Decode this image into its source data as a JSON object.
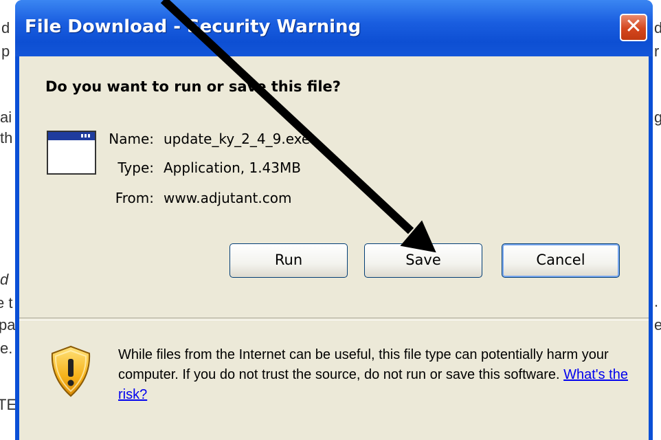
{
  "background": {
    "fragments_left": [
      "d",
      "p",
      "ai",
      "th",
      "d",
      "e t",
      "pa",
      "e.",
      "TE"
    ],
    "fragments_right": [
      "d",
      "r",
      "g",
      ".",
      "e"
    ]
  },
  "dialog": {
    "title": "File Download - Security Warning",
    "close_symbol": "✕",
    "question": "Do you want to run or save this file?",
    "file": {
      "name_label": "Name:",
      "name_value": "update_ky_2_4_9.exe",
      "type_label": "Type:",
      "type_value": "Application, 1.43MB",
      "from_label": "From:",
      "from_value": "www.adjutant.com"
    },
    "buttons": {
      "run": "Run",
      "save": "Save",
      "cancel": "Cancel"
    },
    "warning": {
      "text": "While files from the Internet can be useful, this file type can potentially harm your computer. If you do not trust the source, do not run or save this software. ",
      "link": "What's the risk?"
    },
    "icons": {
      "application": "application-window-icon",
      "warning": "shield-warning-icon",
      "close": "close-icon",
      "annotation": "arrow-annotation"
    },
    "colors": {
      "titlebar": "#0d4fd3",
      "client": "#ece9d8",
      "close": "#d4461e",
      "link": "#0000ee"
    }
  }
}
